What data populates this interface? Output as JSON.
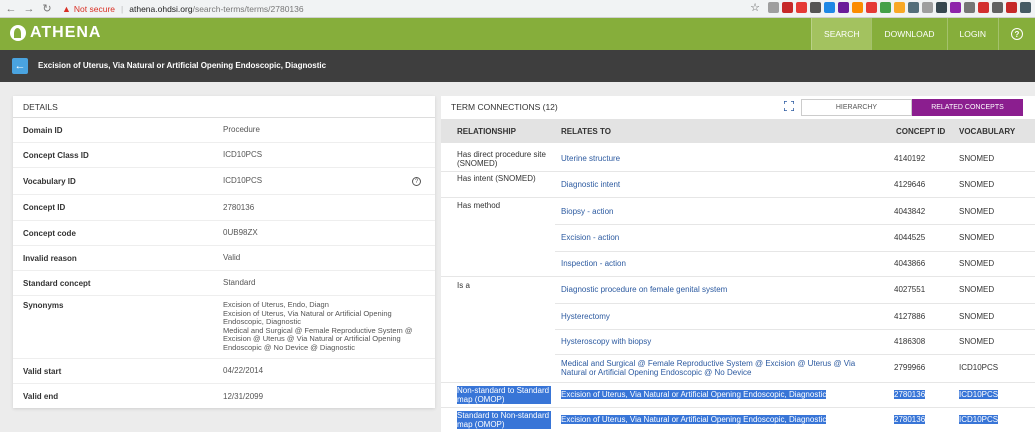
{
  "browser": {
    "not_secure": "Not secure",
    "url_host": "athena.ohdsi.org",
    "url_path": "/search-terms/terms/2780136"
  },
  "app": {
    "logo": "ATHENA",
    "nav": {
      "search": "SEARCH",
      "download": "DOWNLOAD",
      "login": "LOGIN",
      "help": "?"
    }
  },
  "title": "Excision of Uterus, Via Natural or Artificial Opening Endoscopic, Diagnostic",
  "details": {
    "heading": "DETAILS",
    "rows": [
      {
        "label": "Domain ID",
        "value": "Procedure"
      },
      {
        "label": "Concept Class ID",
        "value": "ICD10PCS"
      },
      {
        "label": "Vocabulary ID",
        "value": "ICD10PCS"
      },
      {
        "label": "Concept ID",
        "value": "2780136"
      },
      {
        "label": "Concept code",
        "value": "0UB98ZX"
      },
      {
        "label": "Invalid reason",
        "value": "Valid"
      },
      {
        "label": "Standard concept",
        "value": "Standard"
      },
      {
        "label": "Synonyms",
        "value": ""
      },
      {
        "label": "Valid start",
        "value": "04/22/2014"
      },
      {
        "label": "Valid end",
        "value": "12/31/2099"
      }
    ],
    "synonyms": [
      "Excision of Uterus, Endo, Diagn",
      "Excision of Uterus, Via Natural or Artificial Opening Endoscopic, Diagnostic",
      "Medical and Surgical @ Female Reproductive System @ Excision @ Uterus @ Via Natural or Artificial Opening Endoscopic @ No Device @ Diagnostic"
    ]
  },
  "terms": {
    "heading": "TERM CONNECTIONS (12)",
    "tab_hierarchy": "HIERARCHY",
    "tab_related": "RELATED CONCEPTS",
    "columns": {
      "relationship": "RELATIONSHIP",
      "relates_to": "RELATES TO",
      "concept_id": "CONCEPT ID",
      "vocabulary": "VOCABULARY"
    },
    "rows": [
      {
        "rel": "Has direct procedure site (SNOMED)",
        "to": "Uterine structure",
        "id": "4140192",
        "voc": "SNOMED"
      },
      {
        "rel": "Has intent (SNOMED)",
        "to": "Diagnostic intent",
        "id": "4129646",
        "voc": "SNOMED"
      },
      {
        "rel": "Has method",
        "to": "Biopsy - action",
        "id": "4043842",
        "voc": "SNOMED"
      },
      {
        "rel": "",
        "to": "Excision - action",
        "id": "4044525",
        "voc": "SNOMED"
      },
      {
        "rel": "",
        "to": "Inspection - action",
        "id": "4043866",
        "voc": "SNOMED"
      },
      {
        "rel": "Is a",
        "to": "Diagnostic procedure on female genital system",
        "id": "4027551",
        "voc": "SNOMED"
      },
      {
        "rel": "",
        "to": "Hysterectomy",
        "id": "4127886",
        "voc": "SNOMED"
      },
      {
        "rel": "",
        "to": "Hysteroscopy with biopsy",
        "id": "4186308",
        "voc": "SNOMED"
      },
      {
        "rel": "",
        "to": "Medical and Surgical @ Female Reproductive System @ Excision @ Uterus @ Via Natural or Artificial Opening Endoscopic @ No Device",
        "id": "2799966",
        "voc": "ICD10PCS"
      },
      {
        "rel": "Non-standard to Standard map (OMOP)",
        "to": "Excision of Uterus, Via Natural or Artificial Opening Endoscopic, Diagnostic",
        "id": "2780136",
        "voc": "ICD10PCS"
      },
      {
        "rel": "Standard to Non-standard map (OMOP)",
        "to": "Excision of Uterus, Via Natural or Artificial Opening Endoscopic, Diagnostic",
        "id": "2780136",
        "voc": "ICD10PCS"
      }
    ]
  }
}
